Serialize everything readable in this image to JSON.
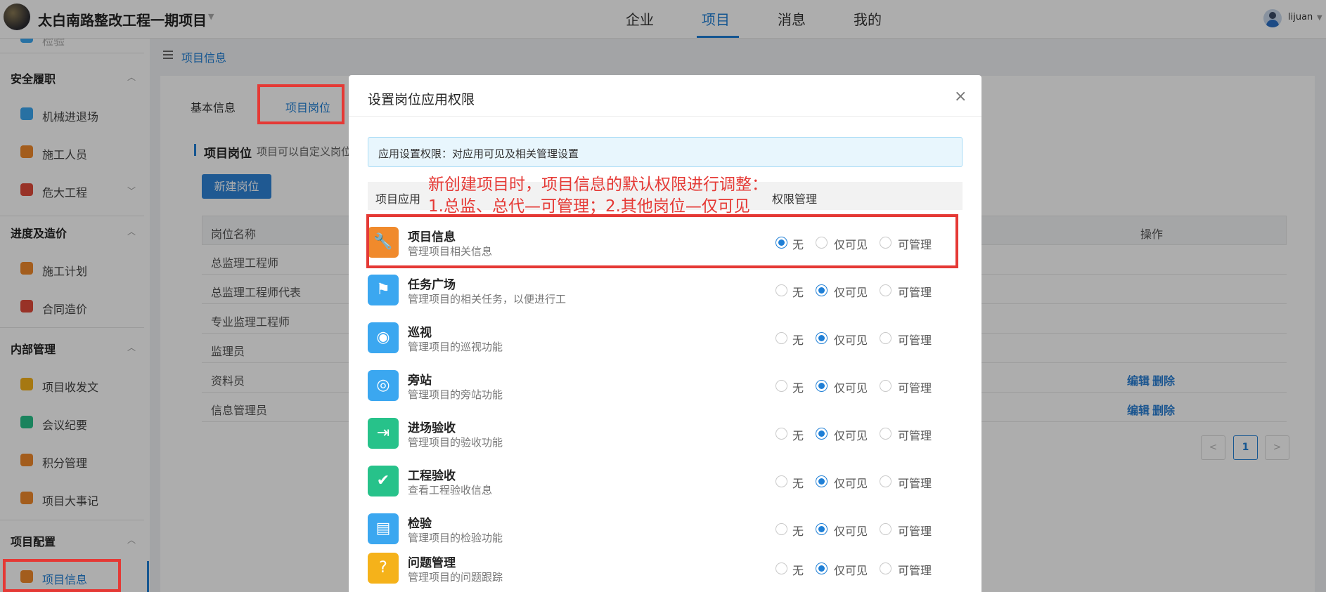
{
  "header": {
    "project_title": "太白南路整改工程一期项目",
    "nav": [
      {
        "label": "企业",
        "active": false
      },
      {
        "label": "项目",
        "active": true
      },
      {
        "label": "消息",
        "active": false
      },
      {
        "label": "我的",
        "active": false
      }
    ],
    "user_name": "lijuan",
    "accent_color": "#1f7fd6"
  },
  "sidebar": {
    "partial_top_item": "检验",
    "groups": [
      {
        "label": "安全履职",
        "items": [
          "机械进退场",
          "施工人员",
          "危大工程"
        ]
      },
      {
        "label": "进度及造价",
        "items": [
          "施工计划",
          "合同造价"
        ]
      },
      {
        "label": "内部管理",
        "items": [
          "项目收发文",
          "会议纪要",
          "积分管理",
          "项目大事记"
        ]
      },
      {
        "label": "项目配置",
        "items": [
          "项目信息"
        ]
      }
    ]
  },
  "main": {
    "breadcrumb": "项目信息",
    "tabs": [
      {
        "label": "基本信息",
        "active": false
      },
      {
        "label": "项目岗位",
        "active": true
      }
    ],
    "section_title": "项目岗位",
    "section_desc": "项目可以自定义岗位",
    "new_button": "新建岗位",
    "table": {
      "col_name": "岗位名称",
      "col_action": "操作",
      "rows": [
        {
          "name": "总监理工程师"
        },
        {
          "name": "总监理工程师代表"
        },
        {
          "name": "专业监理工程师"
        },
        {
          "name": "监理员"
        },
        {
          "name": "资料员",
          "edit": "编辑",
          "delete": "删除"
        },
        {
          "name": "信息管理员",
          "edit": "编辑",
          "delete": "删除"
        }
      ]
    },
    "pagination": {
      "prev": "<",
      "current": "1",
      "next": ">"
    }
  },
  "modal": {
    "title": "设置岗位应用权限",
    "close": "×",
    "info": "应用设置权限：对应用可见及相关管理设置",
    "col_app": "项目应用",
    "col_perm": "权限管理",
    "annotation_line1": "新创建项目时，项目信息的默认权限进行调整：",
    "annotation_line2": "1.总监、总代—可管理；2.其他岗位—仅可见",
    "options": [
      "无",
      "仅可见",
      "可管理"
    ],
    "apps": [
      {
        "name": "项目信息",
        "desc": "管理项目相关信息",
        "selected": 0,
        "color": "#f08a2c",
        "icon": "wrench-icon"
      },
      {
        "name": "任务广场",
        "desc": "管理项目的相关任务，以便进行工",
        "selected": 1,
        "color": "#3ba7f0",
        "icon": "flag-icon"
      },
      {
        "name": "巡视",
        "desc": "管理项目的巡视功能",
        "selected": 1,
        "color": "#3ba7f0",
        "icon": "eye-icon"
      },
      {
        "name": "旁站",
        "desc": "管理项目的旁站功能",
        "selected": 1,
        "color": "#3ba7f0",
        "icon": "signal-icon"
      },
      {
        "name": "进场验收",
        "desc": "管理项目的验收功能",
        "selected": 1,
        "color": "#27c28a",
        "icon": "entry-icon"
      },
      {
        "name": "工程验收",
        "desc": "查看工程验收信息",
        "selected": 1,
        "color": "#27c28a",
        "icon": "folder-check-icon"
      },
      {
        "name": "检验",
        "desc": "管理项目的检验功能",
        "selected": 1,
        "color": "#3ba7f0",
        "icon": "scale-icon"
      },
      {
        "name": "问题管理",
        "desc": "管理项目的问题跟踪",
        "selected": 1,
        "color": "#f5b21a",
        "icon": "question-icon"
      }
    ]
  }
}
